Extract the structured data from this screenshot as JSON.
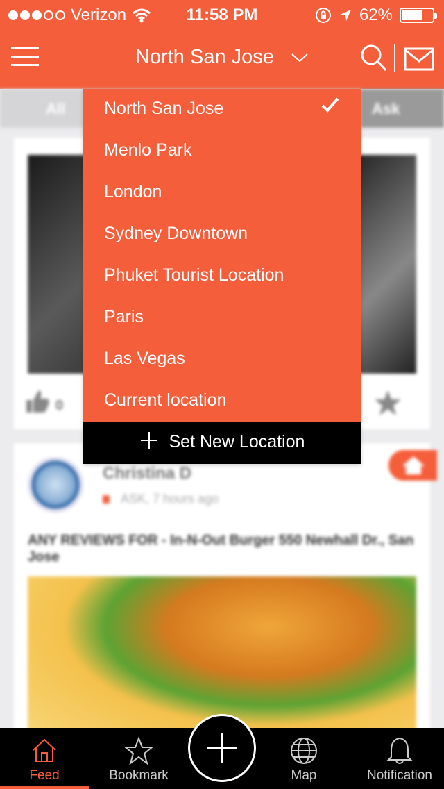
{
  "status_bar": {
    "carrier": "Verizon",
    "time": "11:58 PM",
    "battery": "62%",
    "battery_level": 0.62
  },
  "header": {
    "title": "North San Jose",
    "menu_icon": "hamburger-icon",
    "search_icon": "search-icon",
    "mail_icon": "mail-icon"
  },
  "colors": {
    "accent": "#f55e3b",
    "dark": "#000000"
  },
  "feed": {
    "tabs": [
      "All",
      "Ask"
    ],
    "card1": {
      "like_count": "0"
    },
    "card2": {
      "author": "Christina D",
      "meta": "ASK, 7 hours ago",
      "title": "ANY REVIEWS FOR - In-N-Out Burger 550 Newhall Dr., San Jose"
    }
  },
  "dropdown": {
    "items": [
      {
        "label": "North San Jose",
        "selected": true
      },
      {
        "label": "Menlo Park"
      },
      {
        "label": "London"
      },
      {
        "label": "Sydney Downtown"
      },
      {
        "label": "Phuket Tourist Location"
      },
      {
        "label": "Paris"
      },
      {
        "label": "Las Vegas"
      },
      {
        "label": "Current location"
      }
    ],
    "new_location_label": "Set New Location"
  },
  "tabbar": {
    "feed": "Feed",
    "bookmark": "Bookmark",
    "map": "Map",
    "notification": "Notification",
    "active": "Feed"
  }
}
